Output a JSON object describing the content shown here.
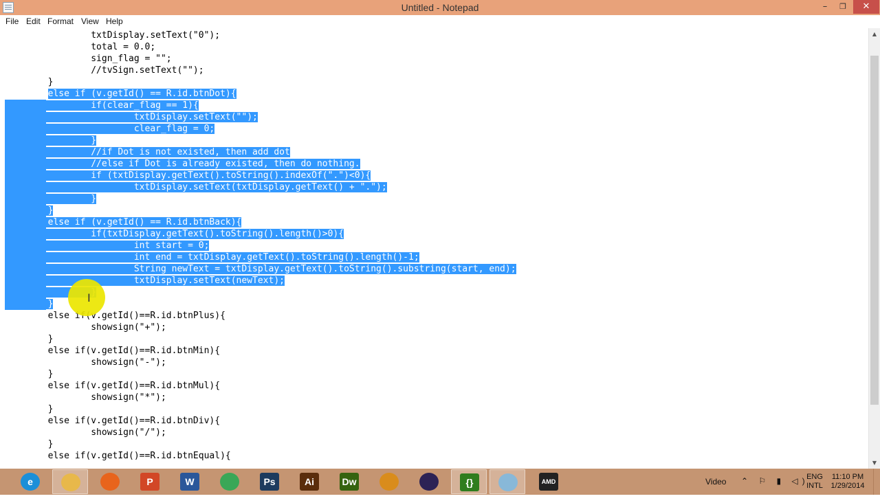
{
  "window": {
    "title": "Untitled - Notepad",
    "min_glyph": "–",
    "max_glyph": "❐",
    "close_glyph": "✕"
  },
  "menu": [
    {
      "label": "File"
    },
    {
      "label": "Edit"
    },
    {
      "label": "Format"
    },
    {
      "label": "View"
    },
    {
      "label": "Help"
    }
  ],
  "editor": {
    "lines": [
      "                txtDisplay.setText(\"0\");",
      "                total = 0.0;",
      "                sign_flag = \"\";",
      "                //tvSign.setText(\"\");",
      "        }",
      "        else if (v.getId() == R.id.btnDot){",
      "                if(clear_flag == 1){",
      "                        txtDisplay.setText(\"\");",
      "                        clear_flag = 0;",
      "                }",
      "                //if Dot is not existed, then add dot",
      "                //else if Dot is already existed, then do nothing.",
      "                if (txtDisplay.getText().toString().indexOf(\".\")<0){",
      "                        txtDisplay.setText(txtDisplay.getText() + \".\");",
      "                }",
      "        }",
      "        else if (v.getId() == R.id.btnBack){",
      "                if(txtDisplay.getText().toString().length()>0){",
      "                        int start = 0;",
      "                        int end = txtDisplay.getText().toString().length()-1;",
      "                        String newText = txtDisplay.getText().toString().substring(start, end);",
      "                        txtDisplay.setText(newText);",
      "                }",
      "        }",
      "        else if(v.getId()==R.id.btnPlus){",
      "                showsign(\"+\");",
      "        }",
      "        else if(v.getId()==R.id.btnMin){",
      "                showsign(\"-\");",
      "        }",
      "        else if(v.getId()==R.id.btnMul){",
      "                showsign(\"*\");",
      "        }",
      "        else if(v.getId()==R.id.btnDiv){",
      "                showsign(\"/\");",
      "        }",
      "        else if(v.getId()==R.id.btnEqual){"
    ],
    "selection_first_line": 5,
    "selection_last_line": 23
  },
  "taskbar": {
    "items": [
      {
        "icon": "internet-explorer-icon",
        "glyph": "e",
        "color": "#1c8fd8",
        "active": false
      },
      {
        "icon": "file-explorer-icon",
        "glyph": "",
        "color": "#e8b84a",
        "active": true
      },
      {
        "icon": "firefox-icon",
        "glyph": "",
        "color": "#e8641c",
        "active": false
      },
      {
        "icon": "powerpoint-icon",
        "glyph": "P",
        "color": "#d24726",
        "active": false
      },
      {
        "icon": "word-icon",
        "glyph": "W",
        "color": "#2b579a",
        "active": false
      },
      {
        "icon": "chrome-icon",
        "glyph": "",
        "color": "#3aa757",
        "active": false
      },
      {
        "icon": "photoshop-icon",
        "glyph": "Ps",
        "color": "#1d3b5e",
        "active": false
      },
      {
        "icon": "illustrator-icon",
        "glyph": "Ai",
        "color": "#5a2d0c",
        "active": false
      },
      {
        "icon": "dreamweaver-icon",
        "glyph": "Dw",
        "color": "#35630f",
        "active": false
      },
      {
        "icon": "flash-folder-icon",
        "glyph": "",
        "color": "#d98c1c",
        "active": false
      },
      {
        "icon": "eclipse-icon",
        "glyph": "",
        "color": "#2c2255",
        "active": false
      },
      {
        "icon": "brackets-icon",
        "glyph": "{}",
        "color": "#2f7d1e",
        "active": true
      },
      {
        "icon": "notepad-icon",
        "glyph": "",
        "color": "#88b8d8",
        "active": true
      },
      {
        "icon": "amd-icon",
        "glyph": "AMD",
        "color": "#222222",
        "active": false
      }
    ],
    "tray": {
      "video_label": "Video",
      "language": "ENG",
      "layout": "INTL",
      "time": "11:10 PM",
      "date": "1/29/2014"
    }
  }
}
